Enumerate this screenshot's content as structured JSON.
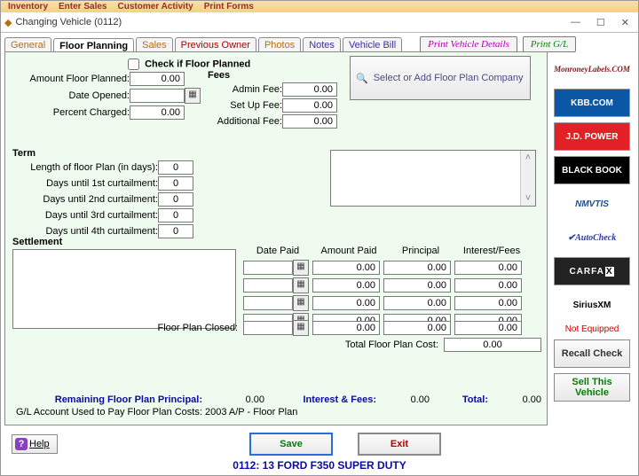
{
  "menubar": {
    "inventory": "Inventory",
    "enter": "Enter Sales",
    "activity": "Customer Activity",
    "forms": "Print Forms"
  },
  "title": "Changing Vehicle  (0112)",
  "tabs": {
    "general": "General",
    "floor": "Floor Planning",
    "sales": "Sales",
    "prev": "Previous Owner",
    "photos": "Photos",
    "notes": "Notes",
    "bill": "Vehicle Bill"
  },
  "actions": {
    "details": "Print Vehicle Details",
    "gl": "Print G/L"
  },
  "check_label": "Check if Floor Planned",
  "labels": {
    "amount": "Amount Floor Planned:",
    "date": "Date Opened:",
    "percent": "Percent Charged:",
    "fees": "Fees",
    "admin": "Admin Fee:",
    "setup": "Set Up Fee:",
    "additional": "Additional Fee:",
    "term": "Term",
    "len": "Length of floor Plan (in days):",
    "c1": "Days until 1st curtailment:",
    "c2": "Days until 2nd curtailment:",
    "c3": "Days until 3rd curtailment:",
    "c4": "Days until 4th curtailment:",
    "settlement": "Settlement",
    "date_paid": "Date Paid",
    "amount_paid": "Amount Paid",
    "principal": "Principal",
    "intfees": "Interest/Fees",
    "closed": "Floor Plan Closed:",
    "total_cost": "Total Floor Plan Cost:",
    "remaining": "Remaining Floor Plan Principal:",
    "interest_fees": "Interest & Fees:",
    "total": "Total:",
    "acct": "G/L Account Used to Pay Floor Plan Costs: 2003 A/P - Floor Plan"
  },
  "values": {
    "amount": "0.00",
    "percent": "0.00",
    "admin": "0.00",
    "setup": "0.00",
    "additional": "0.00",
    "len": "0",
    "c1": "0",
    "c2": "0",
    "c3": "0",
    "c4": "0",
    "row1": [
      "",
      "0.00",
      "0.00",
      "0.00"
    ],
    "row2": [
      "",
      "0.00",
      "0.00",
      "0.00"
    ],
    "row3": [
      "",
      "0.00",
      "0.00",
      "0.00"
    ],
    "row4": [
      "",
      "0.00",
      "0.00",
      "0.00"
    ],
    "closed_amount": "0.00",
    "closed_principal": "0.00",
    "closed_int": "0.00",
    "total_cost": "0.00",
    "remaining": "0.00",
    "interest_fees": "0.00",
    "total": "0.00"
  },
  "select_company": "Select or Add Floor Plan Company",
  "right": {
    "monroney": "MonroneyLabels.COM",
    "kbb": "KBB.COM",
    "jd": "J.D. POWER",
    "black": "BLACK BOOK",
    "nmvtis": "NMVTIS",
    "autocheck": "✔AutoCheck",
    "carfax": "CARFAX",
    "sirius": "SiriusXM",
    "not_equipped": "Not Equipped",
    "recall": "Recall Check",
    "sell": "Sell This Vehicle"
  },
  "buttons": {
    "help": "Help",
    "save": "Save",
    "exit": "Exit"
  },
  "status": "0112:  13 FORD F350 SUPER DUTY"
}
